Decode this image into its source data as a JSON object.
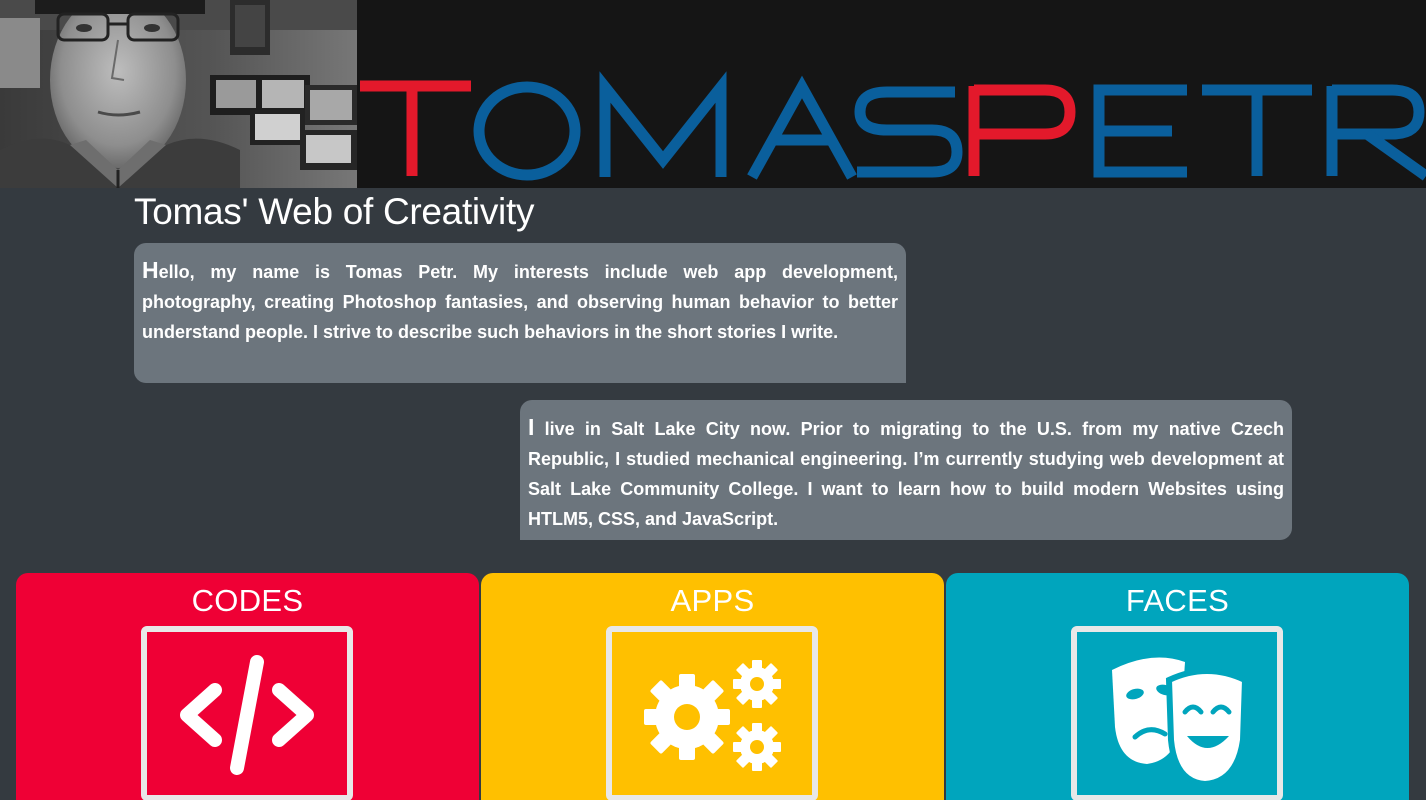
{
  "header": {
    "banner_first": "TOMAS",
    "banner_last": "PETR",
    "portrait_icon": "portrait-photo"
  },
  "title": "Tomas' Web of Creativity",
  "bio": {
    "p1_cap": "H",
    "p1_rest": "ello, my name is Tomas Petr. My interests include web app development, photography, creating Photoshop fantasies, and observing human behavior to better understand people. I strive to describe such behaviors in the short stories I write.",
    "p2_cap": "I",
    "p2_rest": " live in Salt Lake City now. Prior to migrating to the U.S. from my native Czech Republic, I studied mechanical engineering. I’m currently studying web development at Salt Lake Community College. I want to learn how to build modern Websites using HTLM5, CSS, and JavaScript."
  },
  "cards": [
    {
      "label": "CODES",
      "icon": "code-icon",
      "color": "#ef0035"
    },
    {
      "label": "APPS",
      "icon": "gears-icon",
      "color": "#ffc000"
    },
    {
      "label": "FACES",
      "icon": "theater-masks-icon",
      "color": "#00a5bd"
    }
  ],
  "colors": {
    "background": "#343a40",
    "bio_box": "#6c757d",
    "banner_blue": "#0a5f9c",
    "banner_red": "#e3192b"
  }
}
